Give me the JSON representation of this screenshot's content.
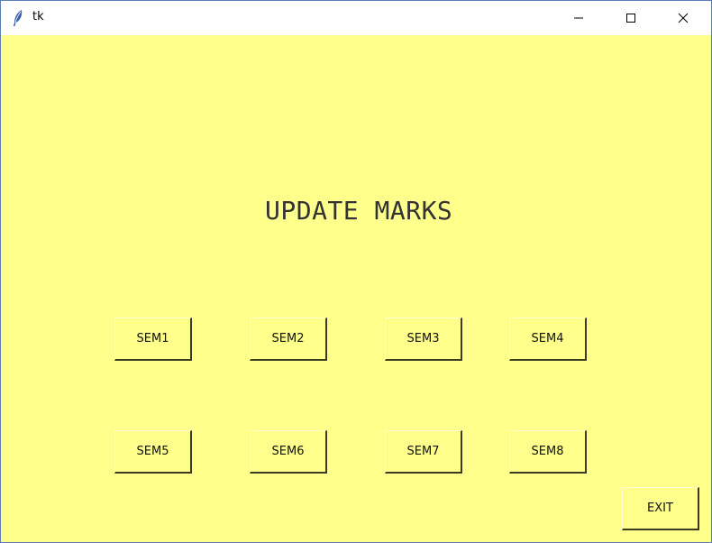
{
  "window": {
    "title": "tk",
    "app_icon": "feather-icon",
    "controls": [
      "minimize-icon",
      "maximize-icon",
      "close-icon"
    ]
  },
  "colors": {
    "background": "#ffff8c",
    "titlebar": "#ffffff",
    "text": "#333333"
  },
  "heading": "UPDATE MARKS",
  "buttons": {
    "sem1": "SEM1",
    "sem2": "SEM2",
    "sem3": "SEM3",
    "sem4": "SEM4",
    "sem5": "SEM5",
    "sem6": "SEM6",
    "sem7": "SEM7",
    "sem8": "SEM8",
    "exit": "EXIT"
  }
}
